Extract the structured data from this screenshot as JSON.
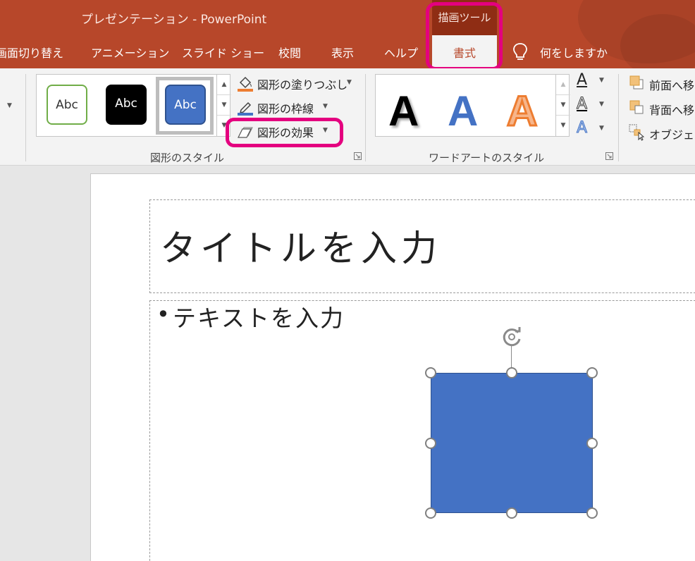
{
  "window": {
    "title": "プレゼンテーション  -  PowerPoint"
  },
  "tabs": {
    "transitions": "画面切り替え",
    "animations": "アニメーション",
    "slideshow": "スライド ショー",
    "review": "校閲",
    "view": "表示",
    "help": "ヘルプ",
    "format": "書式"
  },
  "contextual_tab_label": "描画ツール",
  "tell_me": {
    "placeholder": "何をしますか",
    "icon": "lightbulb-icon"
  },
  "ribbon": {
    "shape_styles": {
      "label": "図形のスタイル",
      "thumbs": [
        {
          "text": "Abc",
          "style": "outline-green"
        },
        {
          "text": "Abc",
          "style": "solid-black"
        },
        {
          "text": "Abc",
          "style": "solid-blue-selected"
        }
      ],
      "shape_fill": "図形の塗りつぶし",
      "shape_outline": "図形の枠線",
      "shape_effects": "図形の効果"
    },
    "wordart_styles": {
      "label": "ワードアートのスタイル",
      "letters": [
        {
          "text": "A",
          "color": "#000000"
        },
        {
          "text": "A",
          "color": "#4472c4"
        },
        {
          "text": "A",
          "color": "#ed7d31"
        }
      ],
      "text_fill_letter": "A",
      "text_outline_letter": "A",
      "text_effects_letter": "A"
    },
    "arrange": {
      "bring_forward": "前面へ移",
      "send_backward": "背面へ移",
      "selection_pane": "オブジェク"
    }
  },
  "slide": {
    "title": "タイトルを入力",
    "bullet": "•",
    "body": "テキストを入力"
  },
  "colors": {
    "accent": "#b7472a",
    "highlight": "#e4007f",
    "shape_fill": "#4472c4"
  }
}
